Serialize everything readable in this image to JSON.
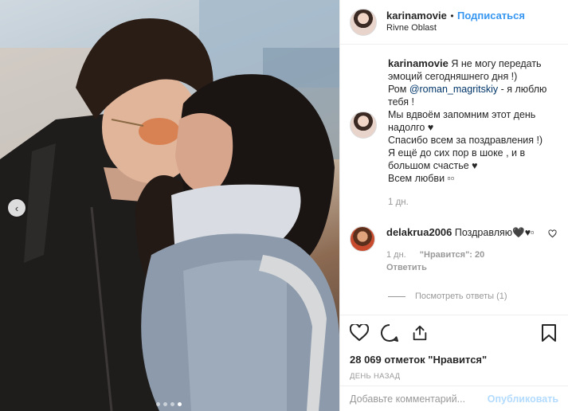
{
  "post": {
    "username": "karinamovie",
    "separator": "•",
    "follow_label": "Подписаться",
    "location": "Rivne Oblast"
  },
  "caption": {
    "username": "karinamovie",
    "line1": "Я не могу передать эмоций сегодняшнего дня !)",
    "line2_prefix": "Ром ",
    "mention": "@roman_magritskiy",
    "line2_suffix": " - я люблю тебя !",
    "line3": "Мы вдвоём запомним этот день надолго ♥",
    "line4": "Спасибо всем за поздравления !)",
    "line5": "Я ещё до сих пор в шоке , и в большом счастье ♥",
    "line6": "Всем любви ▫▫",
    "time": "1 дн."
  },
  "comment": {
    "username": "delakrua2006",
    "text": "Поздравляю🖤♥▫",
    "time": "1 дн.",
    "likes": "\"Нравится\": 20",
    "reply": "Ответить",
    "view_replies": "Посмотреть ответы (1)"
  },
  "actions": {
    "likes_count": "28 069 отметок \"Нравится\"",
    "posted_ago": "ДЕНЬ НАЗАД"
  },
  "add_comment": {
    "placeholder": "Добавьте комментарий...",
    "publish_label": "Опубликовать"
  },
  "carousel": {
    "arrow": "‹",
    "total": 4,
    "active": 4
  },
  "colors": {
    "link": "#3897f0",
    "publish_disabled": "#b3dbff",
    "muted": "#999999"
  }
}
